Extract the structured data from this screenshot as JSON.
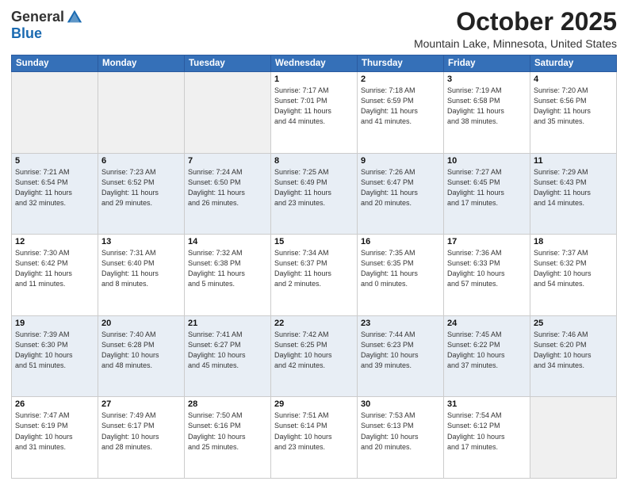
{
  "header": {
    "logo_general": "General",
    "logo_blue": "Blue",
    "month": "October 2025",
    "location": "Mountain Lake, Minnesota, United States"
  },
  "days_of_week": [
    "Sunday",
    "Monday",
    "Tuesday",
    "Wednesday",
    "Thursday",
    "Friday",
    "Saturday"
  ],
  "weeks": [
    [
      {
        "day": "",
        "info": ""
      },
      {
        "day": "",
        "info": ""
      },
      {
        "day": "",
        "info": ""
      },
      {
        "day": "1",
        "info": "Sunrise: 7:17 AM\nSunset: 7:01 PM\nDaylight: 11 hours\nand 44 minutes."
      },
      {
        "day": "2",
        "info": "Sunrise: 7:18 AM\nSunset: 6:59 PM\nDaylight: 11 hours\nand 41 minutes."
      },
      {
        "day": "3",
        "info": "Sunrise: 7:19 AM\nSunset: 6:58 PM\nDaylight: 11 hours\nand 38 minutes."
      },
      {
        "day": "4",
        "info": "Sunrise: 7:20 AM\nSunset: 6:56 PM\nDaylight: 11 hours\nand 35 minutes."
      }
    ],
    [
      {
        "day": "5",
        "info": "Sunrise: 7:21 AM\nSunset: 6:54 PM\nDaylight: 11 hours\nand 32 minutes."
      },
      {
        "day": "6",
        "info": "Sunrise: 7:23 AM\nSunset: 6:52 PM\nDaylight: 11 hours\nand 29 minutes."
      },
      {
        "day": "7",
        "info": "Sunrise: 7:24 AM\nSunset: 6:50 PM\nDaylight: 11 hours\nand 26 minutes."
      },
      {
        "day": "8",
        "info": "Sunrise: 7:25 AM\nSunset: 6:49 PM\nDaylight: 11 hours\nand 23 minutes."
      },
      {
        "day": "9",
        "info": "Sunrise: 7:26 AM\nSunset: 6:47 PM\nDaylight: 11 hours\nand 20 minutes."
      },
      {
        "day": "10",
        "info": "Sunrise: 7:27 AM\nSunset: 6:45 PM\nDaylight: 11 hours\nand 17 minutes."
      },
      {
        "day": "11",
        "info": "Sunrise: 7:29 AM\nSunset: 6:43 PM\nDaylight: 11 hours\nand 14 minutes."
      }
    ],
    [
      {
        "day": "12",
        "info": "Sunrise: 7:30 AM\nSunset: 6:42 PM\nDaylight: 11 hours\nand 11 minutes."
      },
      {
        "day": "13",
        "info": "Sunrise: 7:31 AM\nSunset: 6:40 PM\nDaylight: 11 hours\nand 8 minutes."
      },
      {
        "day": "14",
        "info": "Sunrise: 7:32 AM\nSunset: 6:38 PM\nDaylight: 11 hours\nand 5 minutes."
      },
      {
        "day": "15",
        "info": "Sunrise: 7:34 AM\nSunset: 6:37 PM\nDaylight: 11 hours\nand 2 minutes."
      },
      {
        "day": "16",
        "info": "Sunrise: 7:35 AM\nSunset: 6:35 PM\nDaylight: 11 hours\nand 0 minutes."
      },
      {
        "day": "17",
        "info": "Sunrise: 7:36 AM\nSunset: 6:33 PM\nDaylight: 10 hours\nand 57 minutes."
      },
      {
        "day": "18",
        "info": "Sunrise: 7:37 AM\nSunset: 6:32 PM\nDaylight: 10 hours\nand 54 minutes."
      }
    ],
    [
      {
        "day": "19",
        "info": "Sunrise: 7:39 AM\nSunset: 6:30 PM\nDaylight: 10 hours\nand 51 minutes."
      },
      {
        "day": "20",
        "info": "Sunrise: 7:40 AM\nSunset: 6:28 PM\nDaylight: 10 hours\nand 48 minutes."
      },
      {
        "day": "21",
        "info": "Sunrise: 7:41 AM\nSunset: 6:27 PM\nDaylight: 10 hours\nand 45 minutes."
      },
      {
        "day": "22",
        "info": "Sunrise: 7:42 AM\nSunset: 6:25 PM\nDaylight: 10 hours\nand 42 minutes."
      },
      {
        "day": "23",
        "info": "Sunrise: 7:44 AM\nSunset: 6:23 PM\nDaylight: 10 hours\nand 39 minutes."
      },
      {
        "day": "24",
        "info": "Sunrise: 7:45 AM\nSunset: 6:22 PM\nDaylight: 10 hours\nand 37 minutes."
      },
      {
        "day": "25",
        "info": "Sunrise: 7:46 AM\nSunset: 6:20 PM\nDaylight: 10 hours\nand 34 minutes."
      }
    ],
    [
      {
        "day": "26",
        "info": "Sunrise: 7:47 AM\nSunset: 6:19 PM\nDaylight: 10 hours\nand 31 minutes."
      },
      {
        "day": "27",
        "info": "Sunrise: 7:49 AM\nSunset: 6:17 PM\nDaylight: 10 hours\nand 28 minutes."
      },
      {
        "day": "28",
        "info": "Sunrise: 7:50 AM\nSunset: 6:16 PM\nDaylight: 10 hours\nand 25 minutes."
      },
      {
        "day": "29",
        "info": "Sunrise: 7:51 AM\nSunset: 6:14 PM\nDaylight: 10 hours\nand 23 minutes."
      },
      {
        "day": "30",
        "info": "Sunrise: 7:53 AM\nSunset: 6:13 PM\nDaylight: 10 hours\nand 20 minutes."
      },
      {
        "day": "31",
        "info": "Sunrise: 7:54 AM\nSunset: 6:12 PM\nDaylight: 10 hours\nand 17 minutes."
      },
      {
        "day": "",
        "info": ""
      }
    ]
  ]
}
